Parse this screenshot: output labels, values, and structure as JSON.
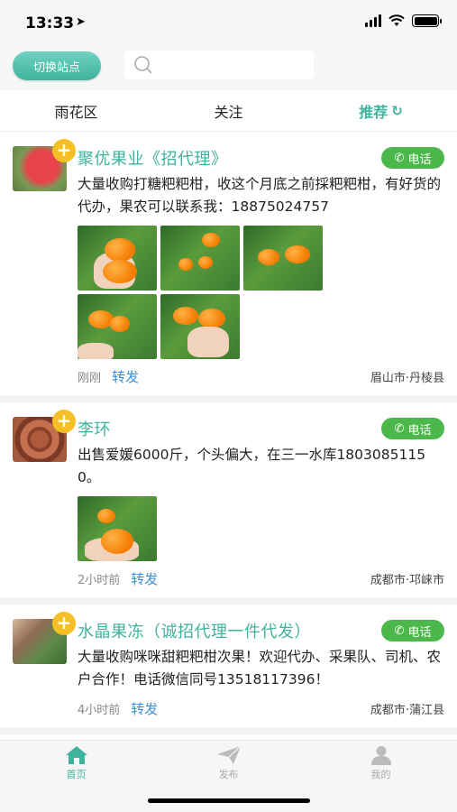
{
  "status_bar": {
    "time": "13:33"
  },
  "header": {
    "switch_label": "切换站点",
    "search_value": "",
    "search_placeholder": ""
  },
  "tabs": [
    {
      "label": "雨花区"
    },
    {
      "label": "关注"
    },
    {
      "label": "推荐",
      "active": true
    }
  ],
  "posts": [
    {
      "name": "聚优果业《招代理》",
      "call_label": "电话",
      "content": "大量收购打糖粑粑柑，收这个月底之前採粑粑柑，有好货的代办，果农可以联系我：18875024757",
      "time": "刚刚",
      "share_label": "转发",
      "location": "眉山市·丹棱县"
    },
    {
      "name": "李环",
      "call_label": "电话",
      "content": "出售爱媛6000斤，个头偏大，在三一水库18030851150。",
      "time": "2小时前",
      "share_label": "转发",
      "location": "成都市·邛崃市"
    },
    {
      "name": "水晶果冻（诚招代理一件代发）",
      "call_label": "电话",
      "content": "大量收购咪咪甜粑粑柑次果！欢迎代办、采果队、司机、农户合作！电话微信同号13518117396！",
      "time": "4小时前",
      "share_label": "转发",
      "location": "成都市·蒲江县"
    }
  ],
  "bottom_nav": [
    {
      "label": "首页",
      "icon": "home-icon",
      "active": true
    },
    {
      "label": "发布",
      "icon": "paper-plane-icon"
    },
    {
      "label": "我的",
      "icon": "user-icon"
    }
  ],
  "colors": {
    "accent": "#3fb39d",
    "call": "#4cb84c",
    "plus": "#f5c026",
    "share": "#3a8fd8"
  }
}
